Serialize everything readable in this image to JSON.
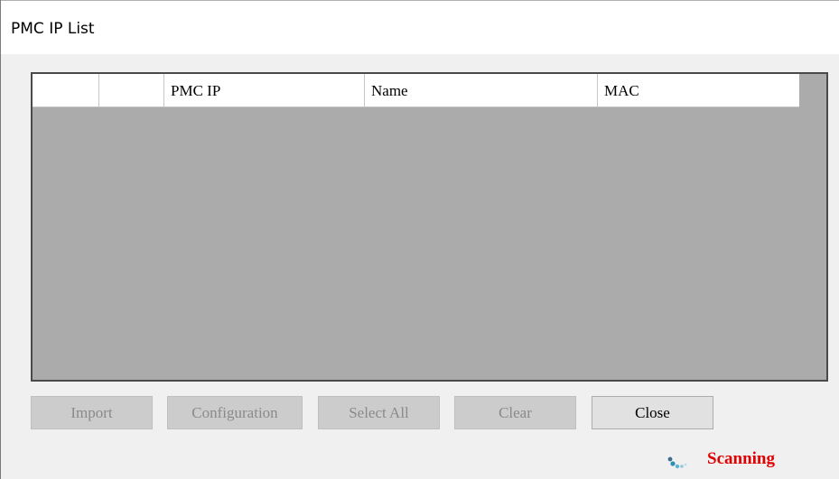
{
  "window": {
    "title": "PMC IP List"
  },
  "table": {
    "columns": [
      "",
      "",
      "PMC IP",
      "Name",
      "MAC"
    ],
    "rows": []
  },
  "buttons": {
    "import": "Import",
    "configuration": "Configuration",
    "select_all": "Select All",
    "clear": "Clear",
    "close": "Close"
  },
  "status": {
    "icon": "loading-spinner-icon",
    "text": "Scanning",
    "color": "#e00000"
  },
  "colors": {
    "grid_background": "#ababab",
    "window_background": "#f0f0f0"
  }
}
